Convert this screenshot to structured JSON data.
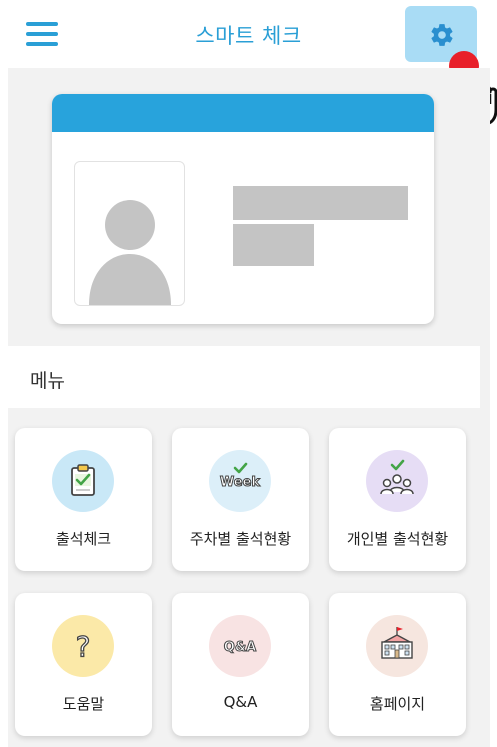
{
  "header": {
    "title": "스마트 체크",
    "menu_icon": "hamburger-icon",
    "settings_icon": "gear-icon",
    "accent_color": "#2a9fd6",
    "settings_bg": "#a9dcf5"
  },
  "id_card": {
    "header_color": "#28a3dc",
    "photo_icon": "person-silhouette-icon"
  },
  "menu": {
    "title": "메뉴",
    "items": [
      {
        "label": "출석체크",
        "icon": "clipboard-check-icon",
        "circle_color": "#c9e8f7"
      },
      {
        "label": "주차별 출석현황",
        "icon": "week-check-icon",
        "icon_text": "Week",
        "circle_color": "#dceff9"
      },
      {
        "label": "개인별 출석현황",
        "icon": "group-check-icon",
        "circle_color": "#e6ddf5"
      },
      {
        "label": "도움말",
        "icon": "question-icon",
        "circle_color": "#fbe9a8"
      },
      {
        "label": "Q&A",
        "icon": "qa-icon",
        "icon_text": "Q&A",
        "circle_color": "#f8e3e3"
      },
      {
        "label": "홈페이지",
        "icon": "school-building-icon",
        "circle_color": "#f6e6df"
      }
    ]
  }
}
